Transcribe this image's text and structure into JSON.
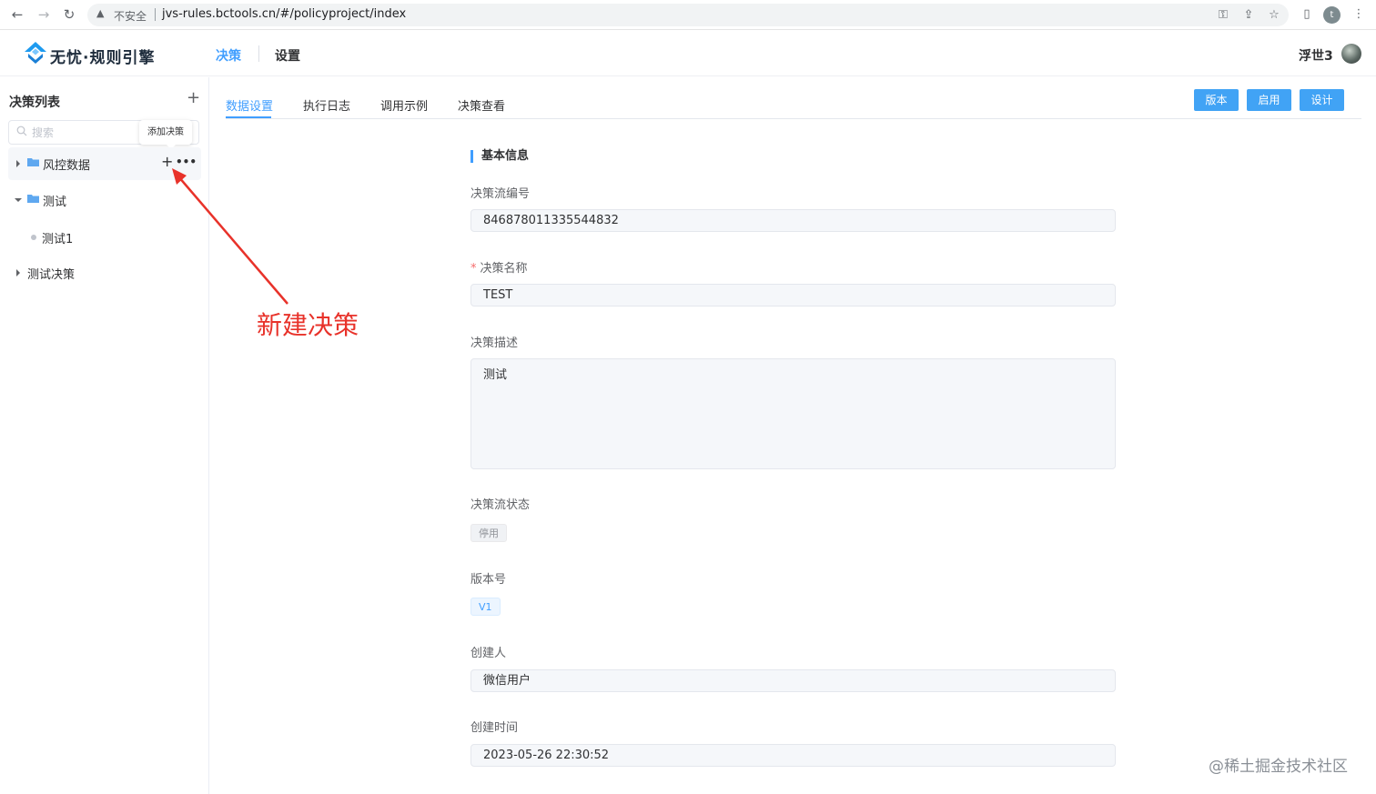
{
  "browser": {
    "insecure_label": "不安全",
    "url": "jvs-rules.bctools.cn/#/policyproject/index",
    "profile_initial": "t"
  },
  "header": {
    "logo_text": "无忧·规则引擎",
    "nav": [
      {
        "label": "决策",
        "active": true
      },
      {
        "label": "设置",
        "active": false
      }
    ],
    "user_name": "浮世3"
  },
  "sidebar": {
    "title": "决策列表",
    "search_placeholder": "搜索",
    "tooltip": "添加决策",
    "tree": [
      {
        "label": "风控数据",
        "type": "folder",
        "expanded": false
      },
      {
        "label": "测试",
        "type": "folder",
        "expanded": true
      },
      {
        "label": "测试1",
        "type": "leaf"
      },
      {
        "label": "测试决策",
        "type": "group",
        "expanded": false
      }
    ]
  },
  "annotation": {
    "text": "新建决策"
  },
  "tabs": [
    "数据设置",
    "执行日志",
    "调用示例",
    "决策查看"
  ],
  "actions": [
    "版本",
    "启用",
    "设计"
  ],
  "form": {
    "section_title": "基本信息",
    "flow_id_label": "决策流编号",
    "flow_id_value": "846878011335544832",
    "name_label": "决策名称",
    "name_value": "TEST",
    "desc_label": "决策描述",
    "desc_value": "测试",
    "status_label": "决策流状态",
    "status_value": "停用",
    "version_label": "版本号",
    "version_value": "V1",
    "creator_label": "创建人",
    "creator_value": "微信用户",
    "created_label": "创建时间",
    "created_value": "2023-05-26 22:30:52"
  },
  "watermark": "@稀土掘金技术社区",
  "colors": {
    "primary": "#409eff",
    "button": "#41a3f5",
    "annotation": "#e8322a"
  }
}
